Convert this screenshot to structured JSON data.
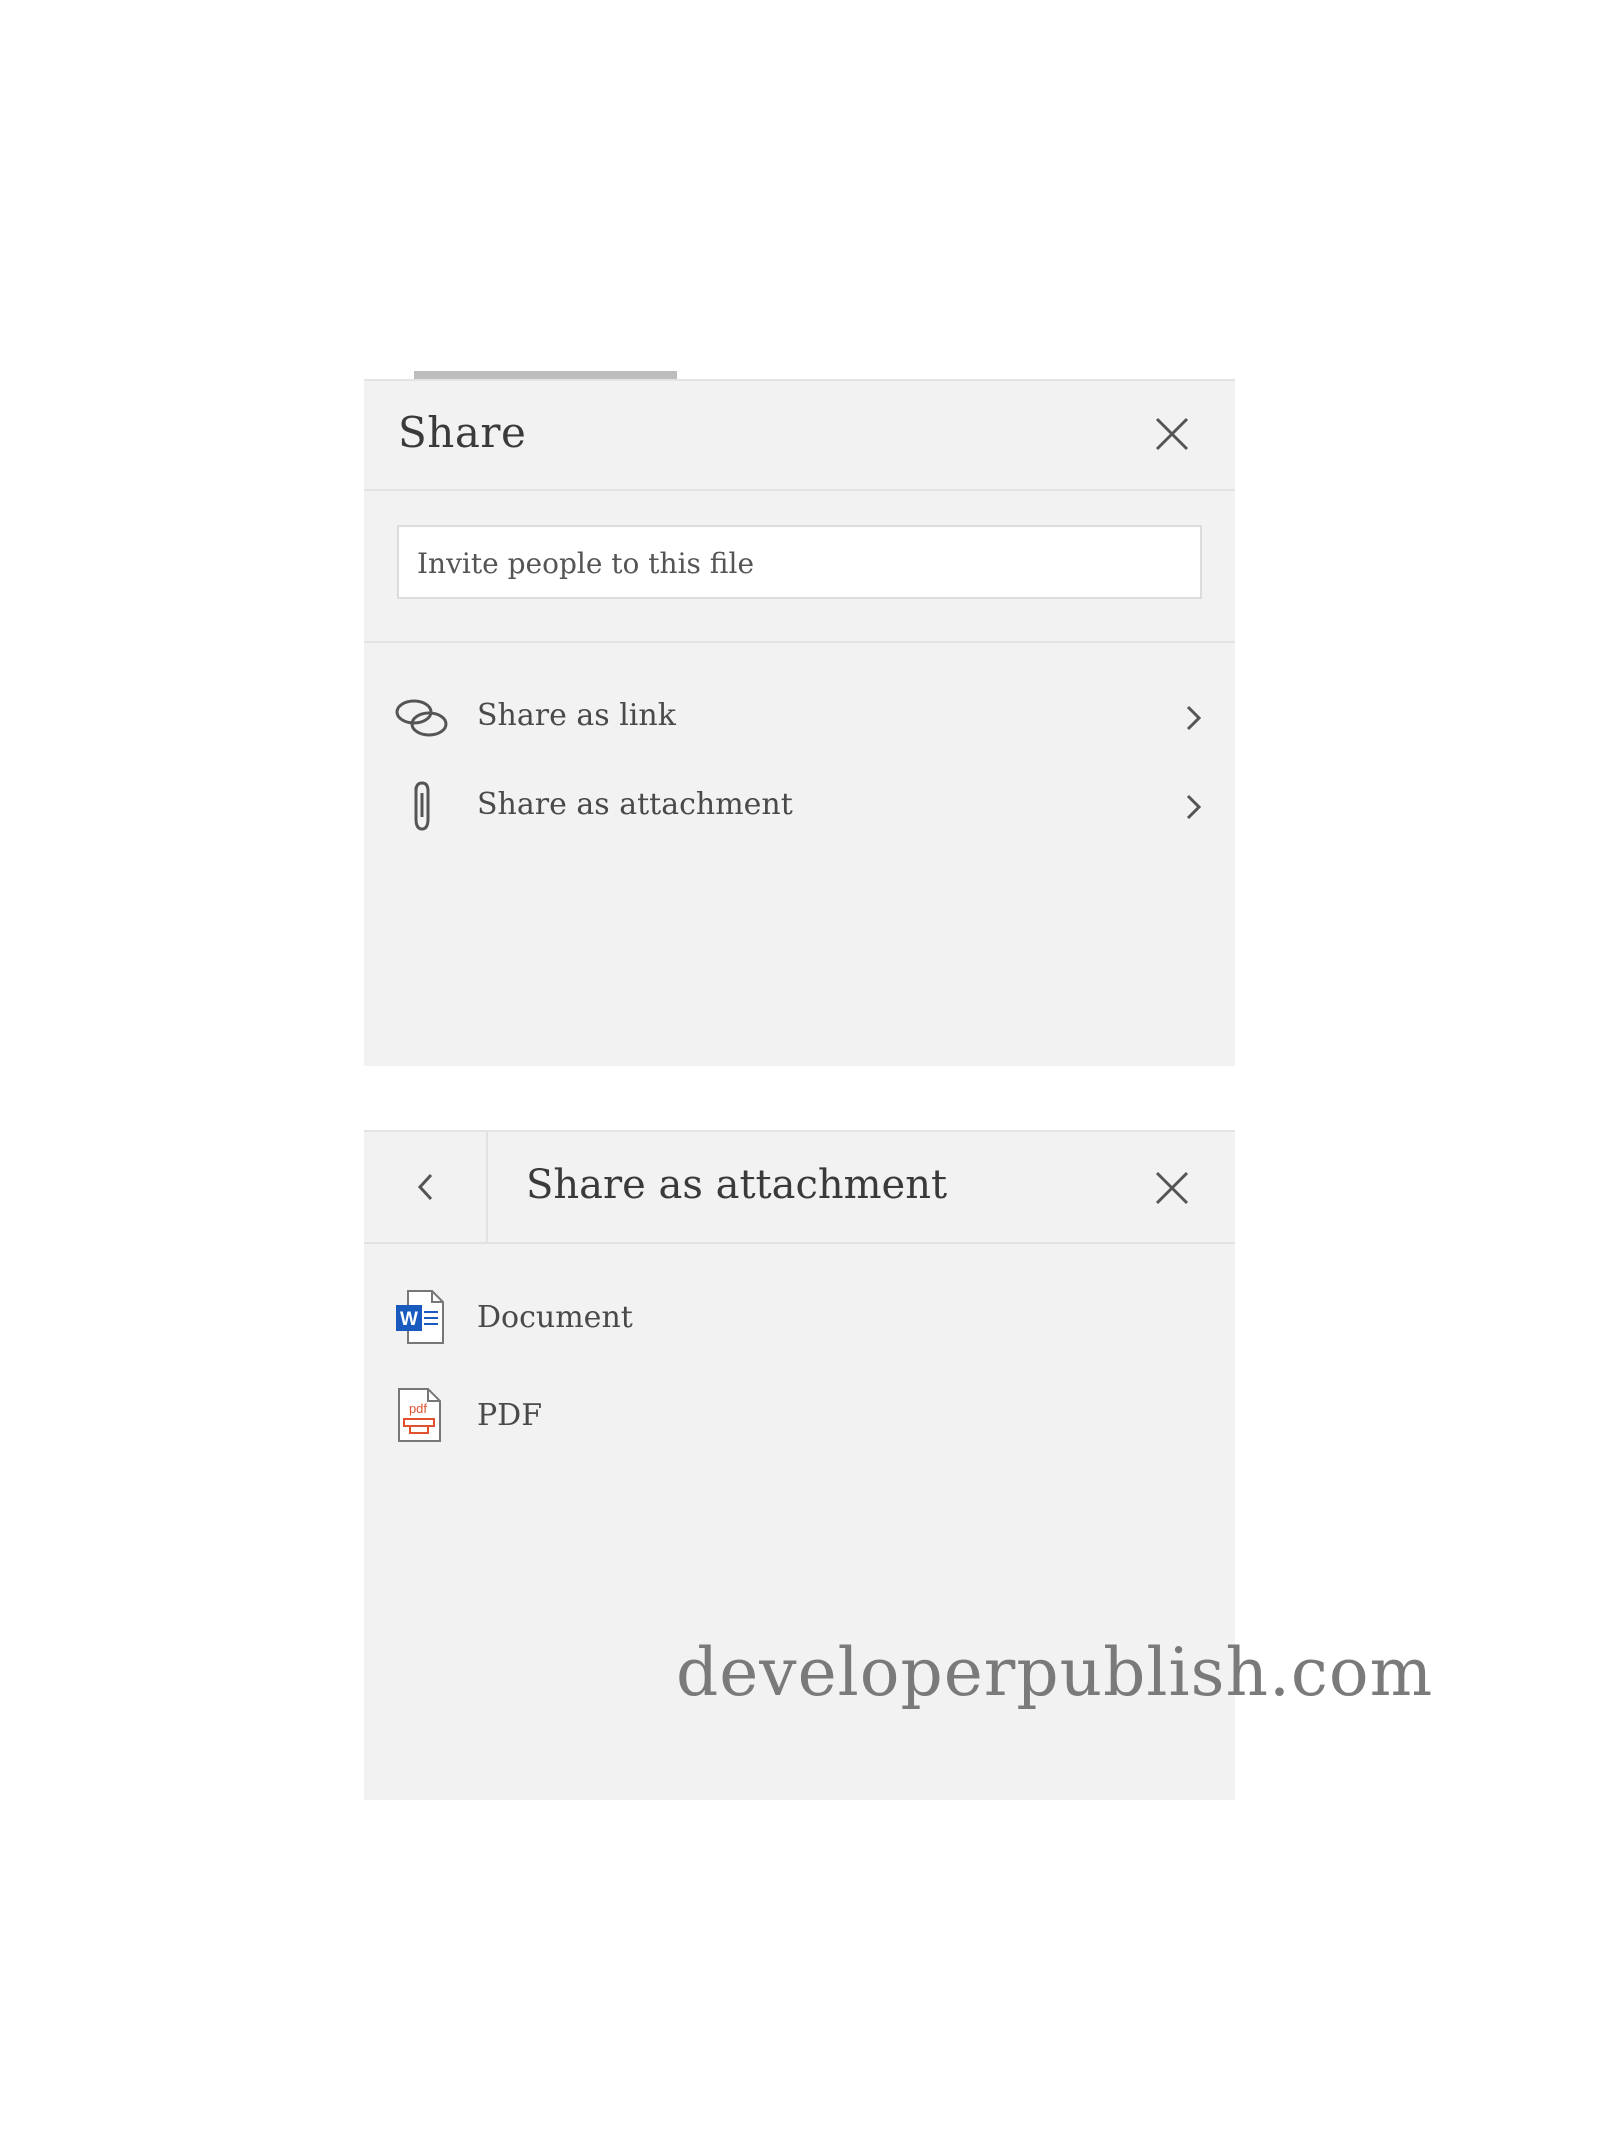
{
  "share_panel": {
    "title": "Share",
    "close_icon": "close-icon",
    "invite_placeholder": "Invite people to this file",
    "options": [
      {
        "label": "Share as link",
        "icon": "link-icon"
      },
      {
        "label": "Share as attachment",
        "icon": "paperclip-icon"
      }
    ]
  },
  "attachment_panel": {
    "title": "Share as attachment",
    "back_icon": "chevron-left-icon",
    "close_icon": "close-icon",
    "files": [
      {
        "label": "Document",
        "icon": "word-document-icon",
        "badge": "W",
        "color": "#185abd"
      },
      {
        "label": "PDF",
        "icon": "pdf-file-icon",
        "badge": "pdf",
        "color": "#e0522e"
      }
    ]
  },
  "watermark": "developerpublish.com"
}
